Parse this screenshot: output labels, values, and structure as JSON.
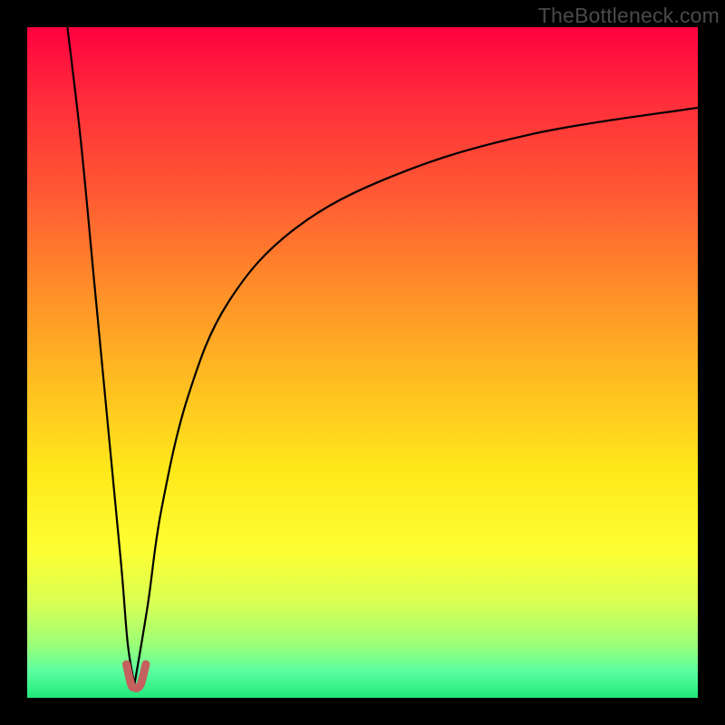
{
  "watermark": "TheBottleneck.com",
  "colors": {
    "frame": "#000000",
    "curve_stroke": "#000000",
    "cap_stroke": "#c4615e",
    "gradient_top": "#ff0040",
    "gradient_bottom": "#20e87a"
  },
  "chart_data": {
    "type": "line",
    "title": "",
    "xlabel": "",
    "ylabel": "",
    "xlim": [
      0,
      100
    ],
    "ylim": [
      0,
      100
    ],
    "note": "y=100 at top (red), y=0 at bottom (green). Single V-shaped curve with minimum at x≈16; left branch steep, right branch shallow asymptote around y≈88.",
    "series": [
      {
        "name": "left-branch",
        "x": [
          6,
          8,
          10,
          12,
          14,
          15,
          16
        ],
        "values": [
          100,
          83,
          62,
          41,
          20,
          8,
          2
        ]
      },
      {
        "name": "right-branch",
        "x": [
          16,
          18,
          20,
          24,
          30,
          40,
          55,
          75,
          100
        ],
        "values": [
          2,
          14,
          28,
          45,
          59,
          70,
          78,
          84,
          88
        ]
      },
      {
        "name": "cap-segment",
        "x": [
          14.8,
          15.5,
          16.0,
          16.5,
          17.0,
          17.7
        ],
        "values": [
          5,
          2.0,
          1.5,
          1.5,
          2.2,
          5
        ],
        "stroke": "#c4615e",
        "stroke_width_px": 9
      }
    ]
  }
}
